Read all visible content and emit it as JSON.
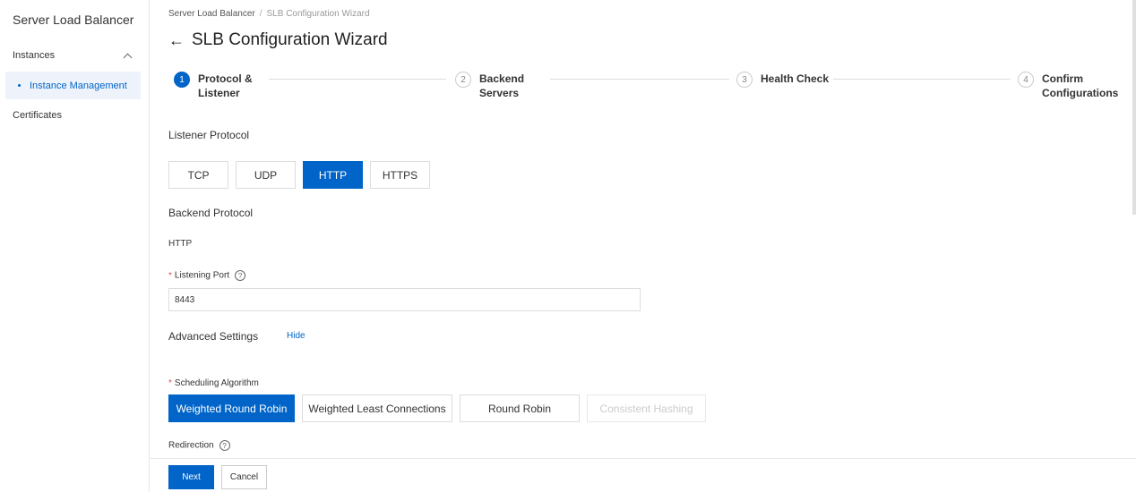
{
  "sidebar": {
    "title": "Server Load Balancer",
    "group": "Instances",
    "active_item": "Instance Management",
    "item_certificates": "Certificates"
  },
  "breadcrumb": {
    "root": "Server Load Balancer",
    "separator": "/",
    "current": "SLB Configuration Wizard"
  },
  "page": {
    "back_glyph": "←",
    "title": "SLB Configuration Wizard"
  },
  "steps": [
    {
      "num": "1",
      "label": "Protocol & Listener",
      "active": true
    },
    {
      "num": "2",
      "label": "Backend Servers",
      "active": false
    },
    {
      "num": "3",
      "label": "Health Check",
      "active": false
    },
    {
      "num": "4",
      "label": "Confirm Configurations",
      "active": false
    }
  ],
  "listener_protocol": {
    "label": "Listener Protocol",
    "options": [
      "TCP",
      "UDP",
      "HTTP",
      "HTTPS"
    ],
    "selected": "HTTP"
  },
  "backend_protocol": {
    "label": "Backend Protocol",
    "value": "HTTP"
  },
  "listening_port": {
    "required_mark": "*",
    "label": "Listening Port",
    "help_glyph": "?",
    "value": "8443"
  },
  "advanced": {
    "label": "Advanced Settings",
    "toggle_label": "Hide"
  },
  "scheduling": {
    "required_mark": "*",
    "label": "Scheduling Algorithm",
    "options": [
      "Weighted Round Robin",
      "Weighted Least Connections",
      "Round Robin",
      "Consistent Hashing"
    ],
    "selected": "Weighted Round Robin",
    "disabled": "Consistent Hashing"
  },
  "redirection": {
    "label": "Redirection",
    "help_glyph": "?"
  },
  "footer": {
    "next_label": "Next",
    "cancel_label": "Cancel"
  },
  "colors": {
    "accent": "#0064c8",
    "required": "#e34d4d"
  }
}
